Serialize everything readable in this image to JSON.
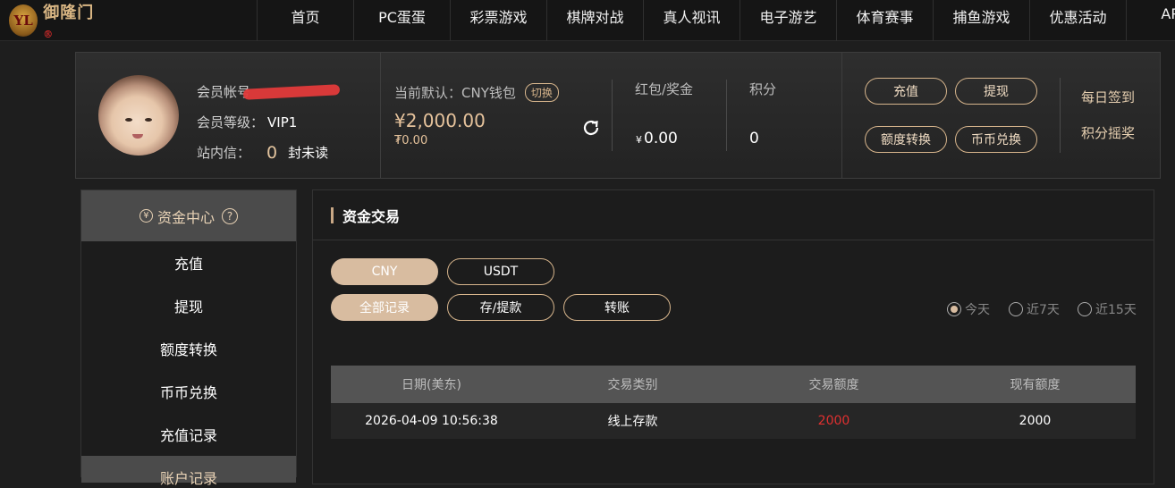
{
  "brand": {
    "logo_mark": "YL",
    "logo_text": "御隆门",
    "logo_badge": "®"
  },
  "nav": [
    "首页",
    "PC蛋蛋",
    "彩票游戏",
    "棋牌对战",
    "真人视讯",
    "电子游艺",
    "体育赛事",
    "捕鱼游戏",
    "优惠活动",
    "APP"
  ],
  "profile": {
    "account_label": "会员帐号",
    "level_label": "会员等级：",
    "level_value": "VIP1",
    "inbox_label": "站内信：",
    "inbox_count": "0",
    "inbox_suffix": "封未读"
  },
  "wallet": {
    "default_label": "当前默认：CNY钱包",
    "switch_label": "切换",
    "balance": "¥2,000.00",
    "balance_sub": "₮0.00",
    "redpacket_label": "红包/奖金",
    "redpacket_currency": "¥",
    "redpacket_value": "0.00",
    "points_label": "积分",
    "points_value": "0"
  },
  "actions": {
    "deposit": "充值",
    "withdraw": "提现",
    "transfer": "额度转换",
    "exchange": "币币兑换",
    "daily_signin": "每日签到",
    "points_lottery": "积分摇奖"
  },
  "sidebar": {
    "header": "资金中心",
    "header_icon": "yen-icon",
    "help_icon": "question-icon",
    "items": [
      "充值",
      "提现",
      "额度转换",
      "币币兑换",
      "充值记录"
    ],
    "next_header": "账户记录"
  },
  "main": {
    "title": "资金交易",
    "currency_tabs": [
      "CNY",
      "USDT"
    ],
    "record_tabs": [
      "全部记录",
      "存/提款",
      "转账"
    ],
    "ranges": [
      "今天",
      "近7天",
      "近15天"
    ],
    "selected_range": "今天",
    "table": {
      "headers": [
        "日期(美东)",
        "交易类别",
        "交易额度",
        "现有额度"
      ],
      "rows": [
        [
          "2026-04-09 10:56:38",
          "线上存款",
          "2000",
          "2000"
        ]
      ]
    }
  },
  "colors": {
    "accent": "#d8bca0",
    "gold_text": "#e6c39c",
    "negative": "#e03030"
  }
}
